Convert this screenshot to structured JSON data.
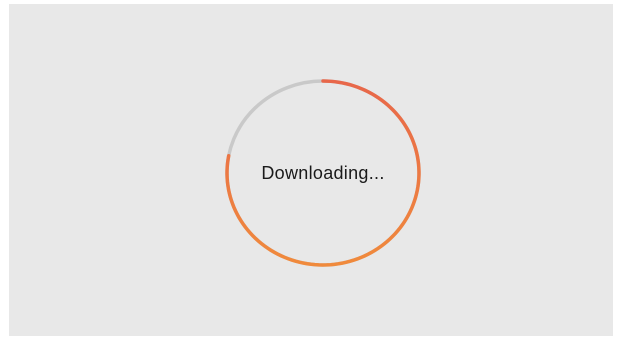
{
  "status": {
    "label": "Downloading..."
  },
  "progress": {
    "fraction": 0.78
  },
  "colors": {
    "background": "#e8e8e8",
    "track": "#c9c9c9",
    "progress_start": "#e8674a",
    "progress_end": "#f08a3c"
  }
}
